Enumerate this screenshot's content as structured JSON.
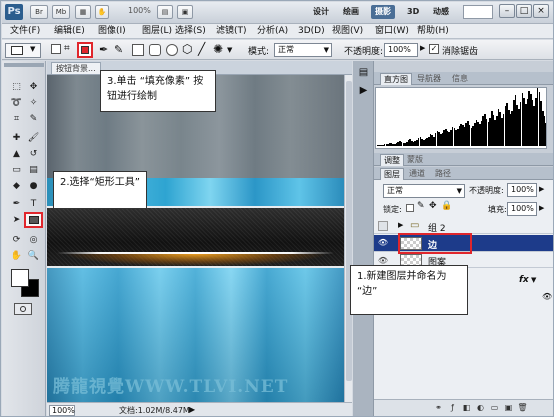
{
  "app": {
    "logo": "Ps",
    "appbar_buttons": [
      "Br",
      "Mb"
    ],
    "zoom": "100%",
    "workspaces": [
      {
        "label": "设计",
        "active": false
      },
      {
        "label": "绘画",
        "active": false
      },
      {
        "label": "摄影",
        "active": true
      },
      {
        "label": "3D",
        "active": false
      },
      {
        "label": "动感",
        "active": false
      }
    ],
    "window_buttons": [
      "–",
      "□",
      "×"
    ]
  },
  "menu": [
    "文件(F)",
    "编辑(E)",
    "图像(I)",
    "图层(L)",
    "选择(S)",
    "滤镜(T)",
    "分析(A)",
    "3D(D)",
    "视图(V)",
    "窗口(W)",
    "帮助(H)"
  ],
  "options": {
    "mode_label": "模式:",
    "mode_value": "正常",
    "opacity_label": "不透明度:",
    "opacity_value": "100%",
    "antialias_label": "消除锯齿",
    "antialias_checked": true
  },
  "document": {
    "tab": "按钮背景...",
    "zoom": "100%",
    "info": "文档:1.02M/8.47M",
    "watermark": "腾龍視覺WWW.TLVI.NET"
  },
  "panels": {
    "histogram_tabs": [
      "直方图",
      "导航器",
      "信息"
    ],
    "adjust_tabs": [
      "调整",
      "蒙版"
    ],
    "layers_tabs": [
      "图层",
      "通道",
      "路径"
    ],
    "blend_mode": "正常",
    "opacity_label": "不透明度:",
    "opacity_value": "100%",
    "lock_label": "锁定:",
    "fill_label": "填充:",
    "fill_value": "100%",
    "layers": [
      {
        "name": "组 2",
        "type": "group",
        "selected": false
      },
      {
        "name": "边",
        "type": "layer",
        "selected": true
      },
      {
        "name": "图案",
        "type": "layer",
        "selected": false
      }
    ],
    "fx_label": "fx"
  },
  "histogram_data": [
    1,
    1,
    1,
    1,
    2,
    2,
    2,
    3,
    3,
    2,
    2,
    3,
    4,
    5,
    4,
    3,
    3,
    4,
    6,
    7,
    5,
    4,
    5,
    6,
    8,
    9,
    7,
    6,
    7,
    8,
    9,
    11,
    10,
    9,
    12,
    14,
    13,
    11,
    12,
    15,
    16,
    14,
    13,
    15,
    18,
    17,
    15,
    16,
    19,
    21,
    20,
    18,
    22,
    24,
    20,
    17,
    19,
    22,
    25,
    23,
    21,
    24,
    28,
    30,
    26,
    23,
    27,
    33,
    29,
    25,
    28,
    35,
    32,
    27,
    30,
    38,
    41,
    34,
    30,
    33,
    44,
    48,
    39,
    35,
    42,
    50,
    46,
    40,
    45,
    52,
    49,
    44,
    38,
    46,
    55,
    51,
    43,
    33,
    28,
    22
  ],
  "callouts": {
    "fill_pixels": "3.单击 “填充像素” 按钮进行绘制",
    "rect_tool": "2.选择“矩形工具”",
    "new_layer": "1.新建图层并命名为 “边”"
  },
  "colors": {
    "highlight": "#e0262c",
    "selected_layer": "#1d3b8a"
  }
}
